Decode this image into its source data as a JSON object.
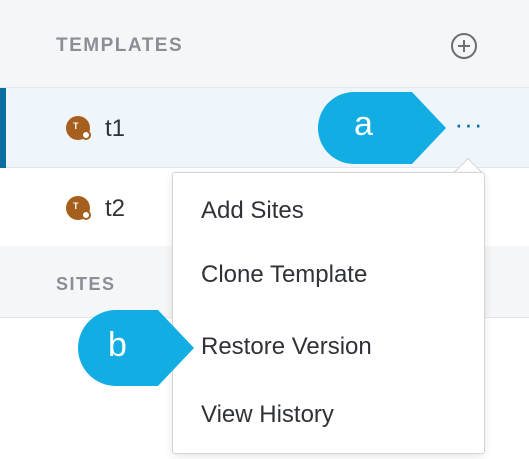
{
  "templates_header": {
    "title": "TEMPLATES",
    "add_icon": "add-circle-icon"
  },
  "rows": [
    {
      "label": "t1",
      "selected": true,
      "icon": "template-icon",
      "icon_letter": "T"
    },
    {
      "label": "t2",
      "selected": false,
      "icon": "template-icon",
      "icon_letter": "T"
    }
  ],
  "more_button": {
    "label": "···",
    "icon": "more-horizontal-icon"
  },
  "menu": {
    "items": [
      {
        "label": "Add Sites"
      },
      {
        "label": "Clone Template"
      },
      {
        "label": "Restore Version"
      },
      {
        "label": "View History"
      }
    ]
  },
  "sites_header": {
    "title": "SITES"
  },
  "callouts": [
    {
      "label": "a"
    },
    {
      "label": "b"
    }
  ],
  "colors": {
    "accent": "#0a6ea3",
    "callout": "#12aee3",
    "template_icon": "#a65f1c",
    "selected_row": "#eef5fb",
    "header_bg": "#f5f6f7"
  }
}
